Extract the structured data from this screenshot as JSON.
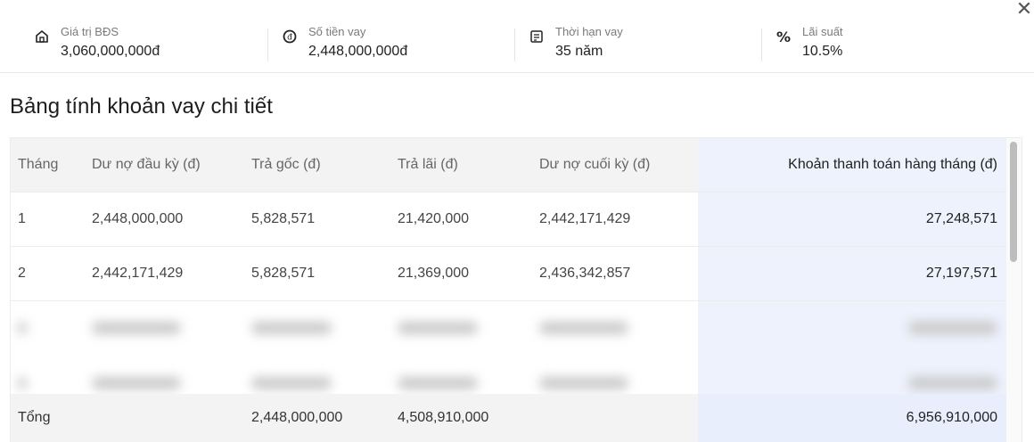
{
  "summary": {
    "property_value": {
      "label": "Giá trị BĐS",
      "value": "3,060,000,000đ",
      "icon": "house-icon"
    },
    "loan_amount": {
      "label": "Số tiền vay",
      "value": "2,448,000,000đ",
      "icon": "dong-coin-icon"
    },
    "loan_term": {
      "label": "Thời hạn vay",
      "value": "35 năm",
      "icon": "calendar-icon"
    },
    "interest_rate": {
      "label": "Lãi suất",
      "value": "10.5%",
      "icon": "percent-icon"
    }
  },
  "close_icon": "close-icon",
  "title": "Bảng tính khoản vay chi tiết",
  "table": {
    "headers": [
      "Tháng",
      "Dư nợ đầu kỳ (đ)",
      "Trả gốc (đ)",
      "Trả lãi (đ)",
      "Dư nợ cuối kỳ (đ)",
      "Khoản thanh toán hàng tháng (đ)"
    ],
    "rows": [
      [
        "1",
        "2,448,000,000",
        "5,828,571",
        "21,420,000",
        "2,442,171,429",
        "27,248,571"
      ],
      [
        "2",
        "2,442,171,429",
        "5,828,571",
        "21,369,000",
        "2,436,342,857",
        "27,197,571"
      ]
    ],
    "total": [
      "Tổng",
      "",
      "2,448,000,000",
      "4,508,910,000",
      "",
      "6,956,910,000"
    ]
  },
  "colors": {
    "highlight_column": "#eef2fd",
    "header_bg": "#f3f3f3"
  }
}
